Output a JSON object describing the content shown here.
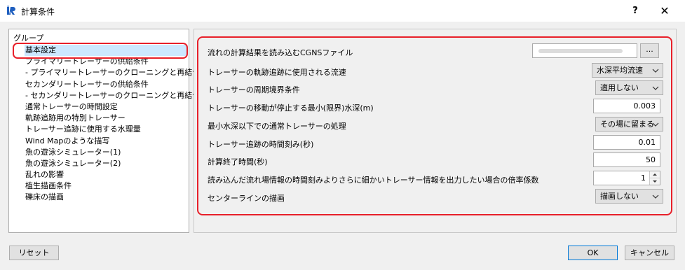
{
  "window": {
    "title": "計算条件",
    "help_label": "?",
    "close_label": "✕"
  },
  "tree": {
    "root": "グループ",
    "items": [
      {
        "label": "基本設定",
        "selected": true
      },
      {
        "label": "プライマリートレーサーの供給条件"
      },
      {
        "label": "- プライマリートレーサーのクローニングと再結合"
      },
      {
        "label": "セカンダリートレーサーの供給条件"
      },
      {
        "label": "- セカンダリートレーサーのクローニングと再結合"
      },
      {
        "label": "通常トレーサーの時間設定"
      },
      {
        "label": "軌跡追跡用の特別トレーサー"
      },
      {
        "label": "トレーサー追跡に使用する水理量"
      },
      {
        "label": "Wind Mapのような描写"
      },
      {
        "label": "魚の遊泳シミュレーター(1)"
      },
      {
        "label": "魚の遊泳シミュレーター(2)"
      },
      {
        "label": "乱れの影響"
      },
      {
        "label": "植生描画条件"
      },
      {
        "label": "礫床の描画"
      }
    ]
  },
  "settings": {
    "cgns_file": {
      "label": "流れの計算結果を読み込むCGNSファイル",
      "browse_label": "..."
    },
    "velocity": {
      "label": "トレーサーの軌跡追跡に使用される流速",
      "value": "水深平均流速"
    },
    "boundary": {
      "label": "トレーサーの周期境界条件",
      "value": "適用しない"
    },
    "min_depth": {
      "label": "トレーサーの移動が停止する最小(限界)水深(m)",
      "value": "0.003"
    },
    "below_min": {
      "label": "最小水深以下での通常トレーサーの処理",
      "value": "その場に留まる"
    },
    "dt": {
      "label": "トレーサー追跡の時間刻み(秒)",
      "value": "0.01"
    },
    "end_time": {
      "label": "計算終了時間(秒)",
      "value": "50"
    },
    "output_ratio": {
      "label": "読み込んだ流れ場情報の時間刻みよりさらに細かいトレーサー情報を出力したい場合の倍率係数",
      "value": "1"
    },
    "centerline": {
      "label": "センターラインの描画",
      "value": "描画しない"
    }
  },
  "buttons": {
    "reset": "リセット",
    "ok": "OK",
    "cancel": "キャンセル"
  },
  "colors": {
    "highlight": "#e8202a",
    "selection": "#cce8ff",
    "default_button_border": "#0078d7"
  }
}
